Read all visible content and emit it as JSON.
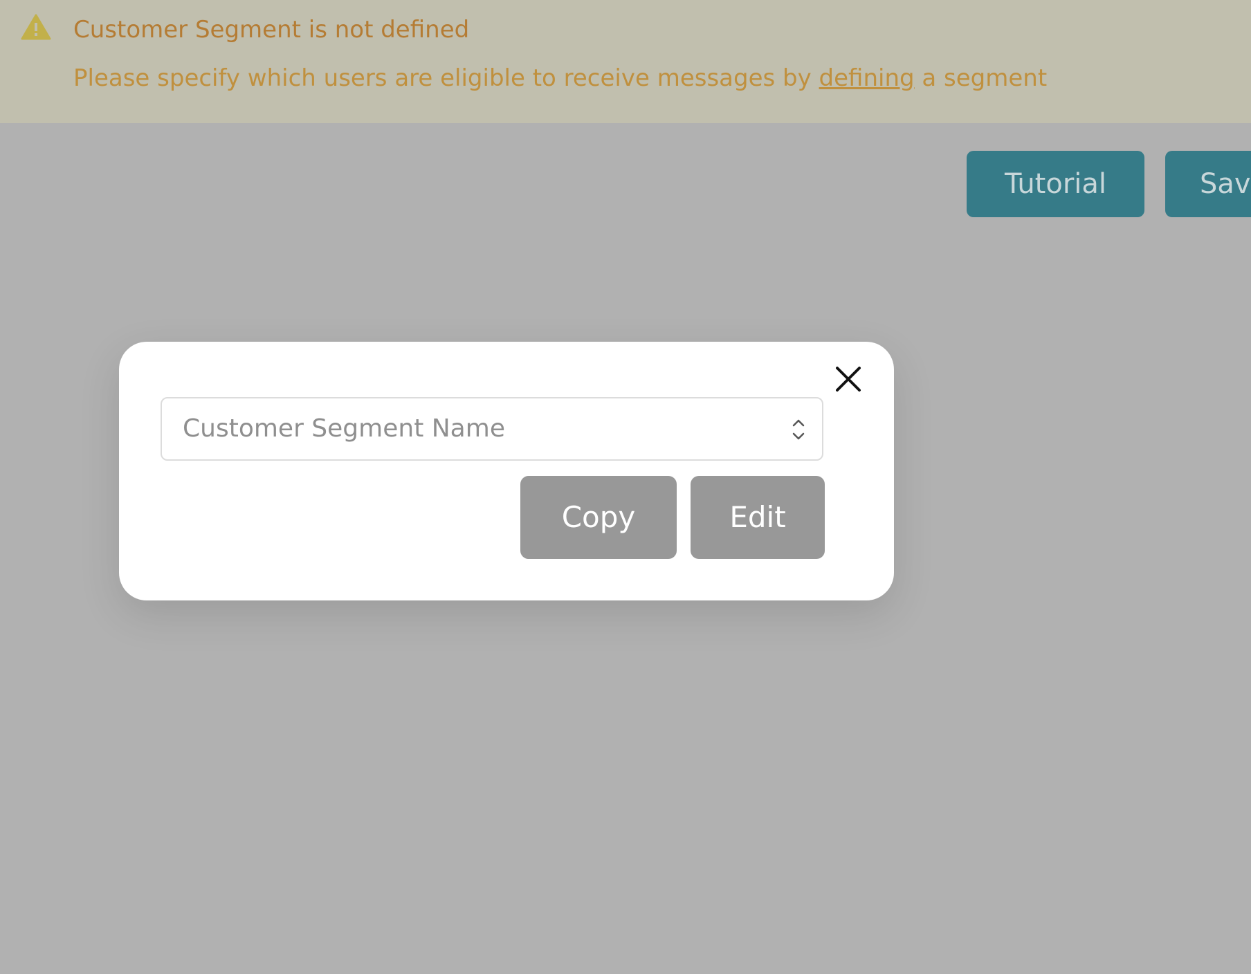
{
  "banner": {
    "icon": "warning-triangle-icon",
    "title": "Customer Segment is not defined",
    "message_before": "Please specify which users are eligible to receive messages by ",
    "message_link": "defining",
    "message_after": " a segment",
    "colors": {
      "background": "#c1bfae",
      "title": "#b57c34",
      "message": "#c0903e",
      "icon": "#c2b04a"
    }
  },
  "toolbar": {
    "tutorial_label": "Tutorial",
    "save_label": "Save",
    "button_color": "#367b88"
  },
  "modal": {
    "close_icon": "close-icon",
    "select_placeholder": "Customer Segment Name",
    "copy_label": "Copy",
    "edit_label": "Edit",
    "button_color": "#989898"
  },
  "overlay_color": "#b1b1b1"
}
